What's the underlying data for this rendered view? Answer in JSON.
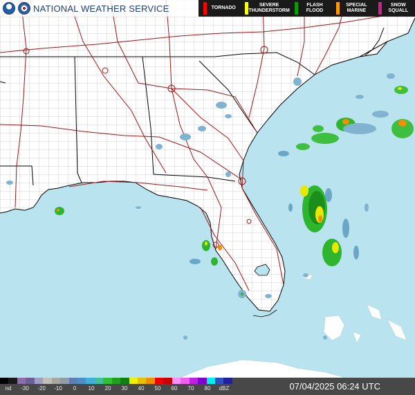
{
  "header": {
    "title": "NATIONAL WEATHER SERVICE",
    "logos": [
      "noaa-logo",
      "nws-logo"
    ]
  },
  "warnings_legend": [
    {
      "label": "TORNADO",
      "color": "#ff0000"
    },
    {
      "label": "SEVERE\nTHUNDERSTORM",
      "color": "#ffff00"
    },
    {
      "label": "FLASH\nFLOOD",
      "color": "#00a000"
    },
    {
      "label": "SPECIAL\nMARINE",
      "color": "#ff9900"
    },
    {
      "label": "SNOW\nSQUALL",
      "color": "#d0208c"
    }
  ],
  "reflectivity_scale": {
    "labels": [
      "nd",
      "-30",
      "-20",
      "-10",
      "0",
      "10",
      "20",
      "30",
      "40",
      "50",
      "60",
      "70",
      "80",
      "dBZ"
    ],
    "colors": [
      "#000000",
      "#1a1a1a",
      "#8a6fa8",
      "#6f5f96",
      "#9e9ec7",
      "#c0c0b8",
      "#a8a8a0",
      "#8f9fa8",
      "#5f7fb0",
      "#4f8fc8",
      "#40b0d8",
      "#40c0a0",
      "#30c030",
      "#20a020",
      "#108010",
      "#f0f000",
      "#e8c000",
      "#f09000",
      "#f00000",
      "#c80000",
      "#ff90ff",
      "#f060f0",
      "#c020e0",
      "#8000d0",
      "#00f0f0",
      "#3050c0",
      "#2020a0"
    ]
  },
  "timestamp": "07/04/2025 06:24 UTC",
  "colors": {
    "water": "#b9e3ef",
    "land": "#ffffff",
    "state_border": "#000000",
    "county_border": "#9a9a9a",
    "highway": "#a01515"
  }
}
